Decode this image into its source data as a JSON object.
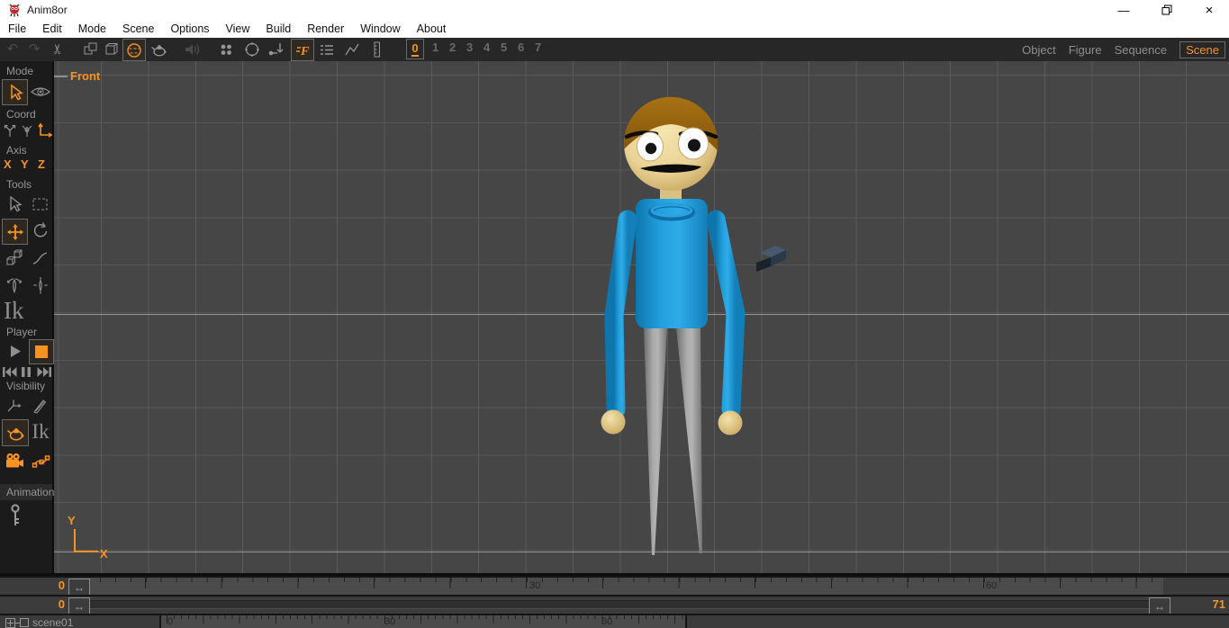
{
  "window": {
    "title": "Anim8or",
    "controls": [
      "minimize-icon",
      "restore-icon",
      "close-icon"
    ]
  },
  "menubar": {
    "items": [
      "File",
      "Edit",
      "Mode",
      "Scene",
      "Options",
      "View",
      "Build",
      "Render",
      "Window",
      "About"
    ]
  },
  "toolbar": {
    "icons": [
      "undo-icon",
      "redo-icon",
      "cut-icon",
      "copy-icon",
      "paste-icon",
      "sphere-select-icon",
      "render-preview-icon",
      "sound-icon",
      "key-dots-icon",
      "ring-icon",
      "drop-key-icon",
      "fast-render-icon",
      "track-list-icon",
      "graph-editor-icon",
      "scale-ruler-icon"
    ],
    "undo_glyph": "↶",
    "redo_glyph": "↷",
    "cut_glyph": "✂",
    "frames": [
      "0",
      "1",
      "2",
      "3",
      "4",
      "5",
      "6",
      "7"
    ],
    "active_frame": "0",
    "modes": [
      "Object",
      "Figure",
      "Sequence",
      "Scene"
    ],
    "active_mode": "Scene"
  },
  "sidebar": {
    "labels": {
      "mode": "Mode",
      "coord": "Coord",
      "axis": "Axis",
      "tools": "Tools",
      "ik": "Ik",
      "player": "Player",
      "visibility": "Visibility",
      "animation": "Animation"
    },
    "axis_buttons": {
      "x": "X",
      "y": "Y",
      "z": "Z"
    },
    "visibility_ik": "Ik"
  },
  "viewport": {
    "view_label": "Front",
    "axis_indicator": {
      "y": "Y",
      "x": "X"
    },
    "handle_glyph": "↔"
  },
  "timeline": {
    "track1_value": "0",
    "track2_value": "0",
    "end_frame": "71",
    "ruler1_labels": [
      "30",
      "60"
    ],
    "ruler3_labels": [
      "0",
      "30",
      "60"
    ],
    "scene_name": "scene01"
  },
  "colors": {
    "accent": "#f79320",
    "shirt": "#229fdd",
    "skin": "#ecd79c",
    "hair": "#9c6410",
    "legs": "#9a9a9a",
    "viewport_bg": "#464646",
    "grid_line": "#5b5b5b"
  }
}
